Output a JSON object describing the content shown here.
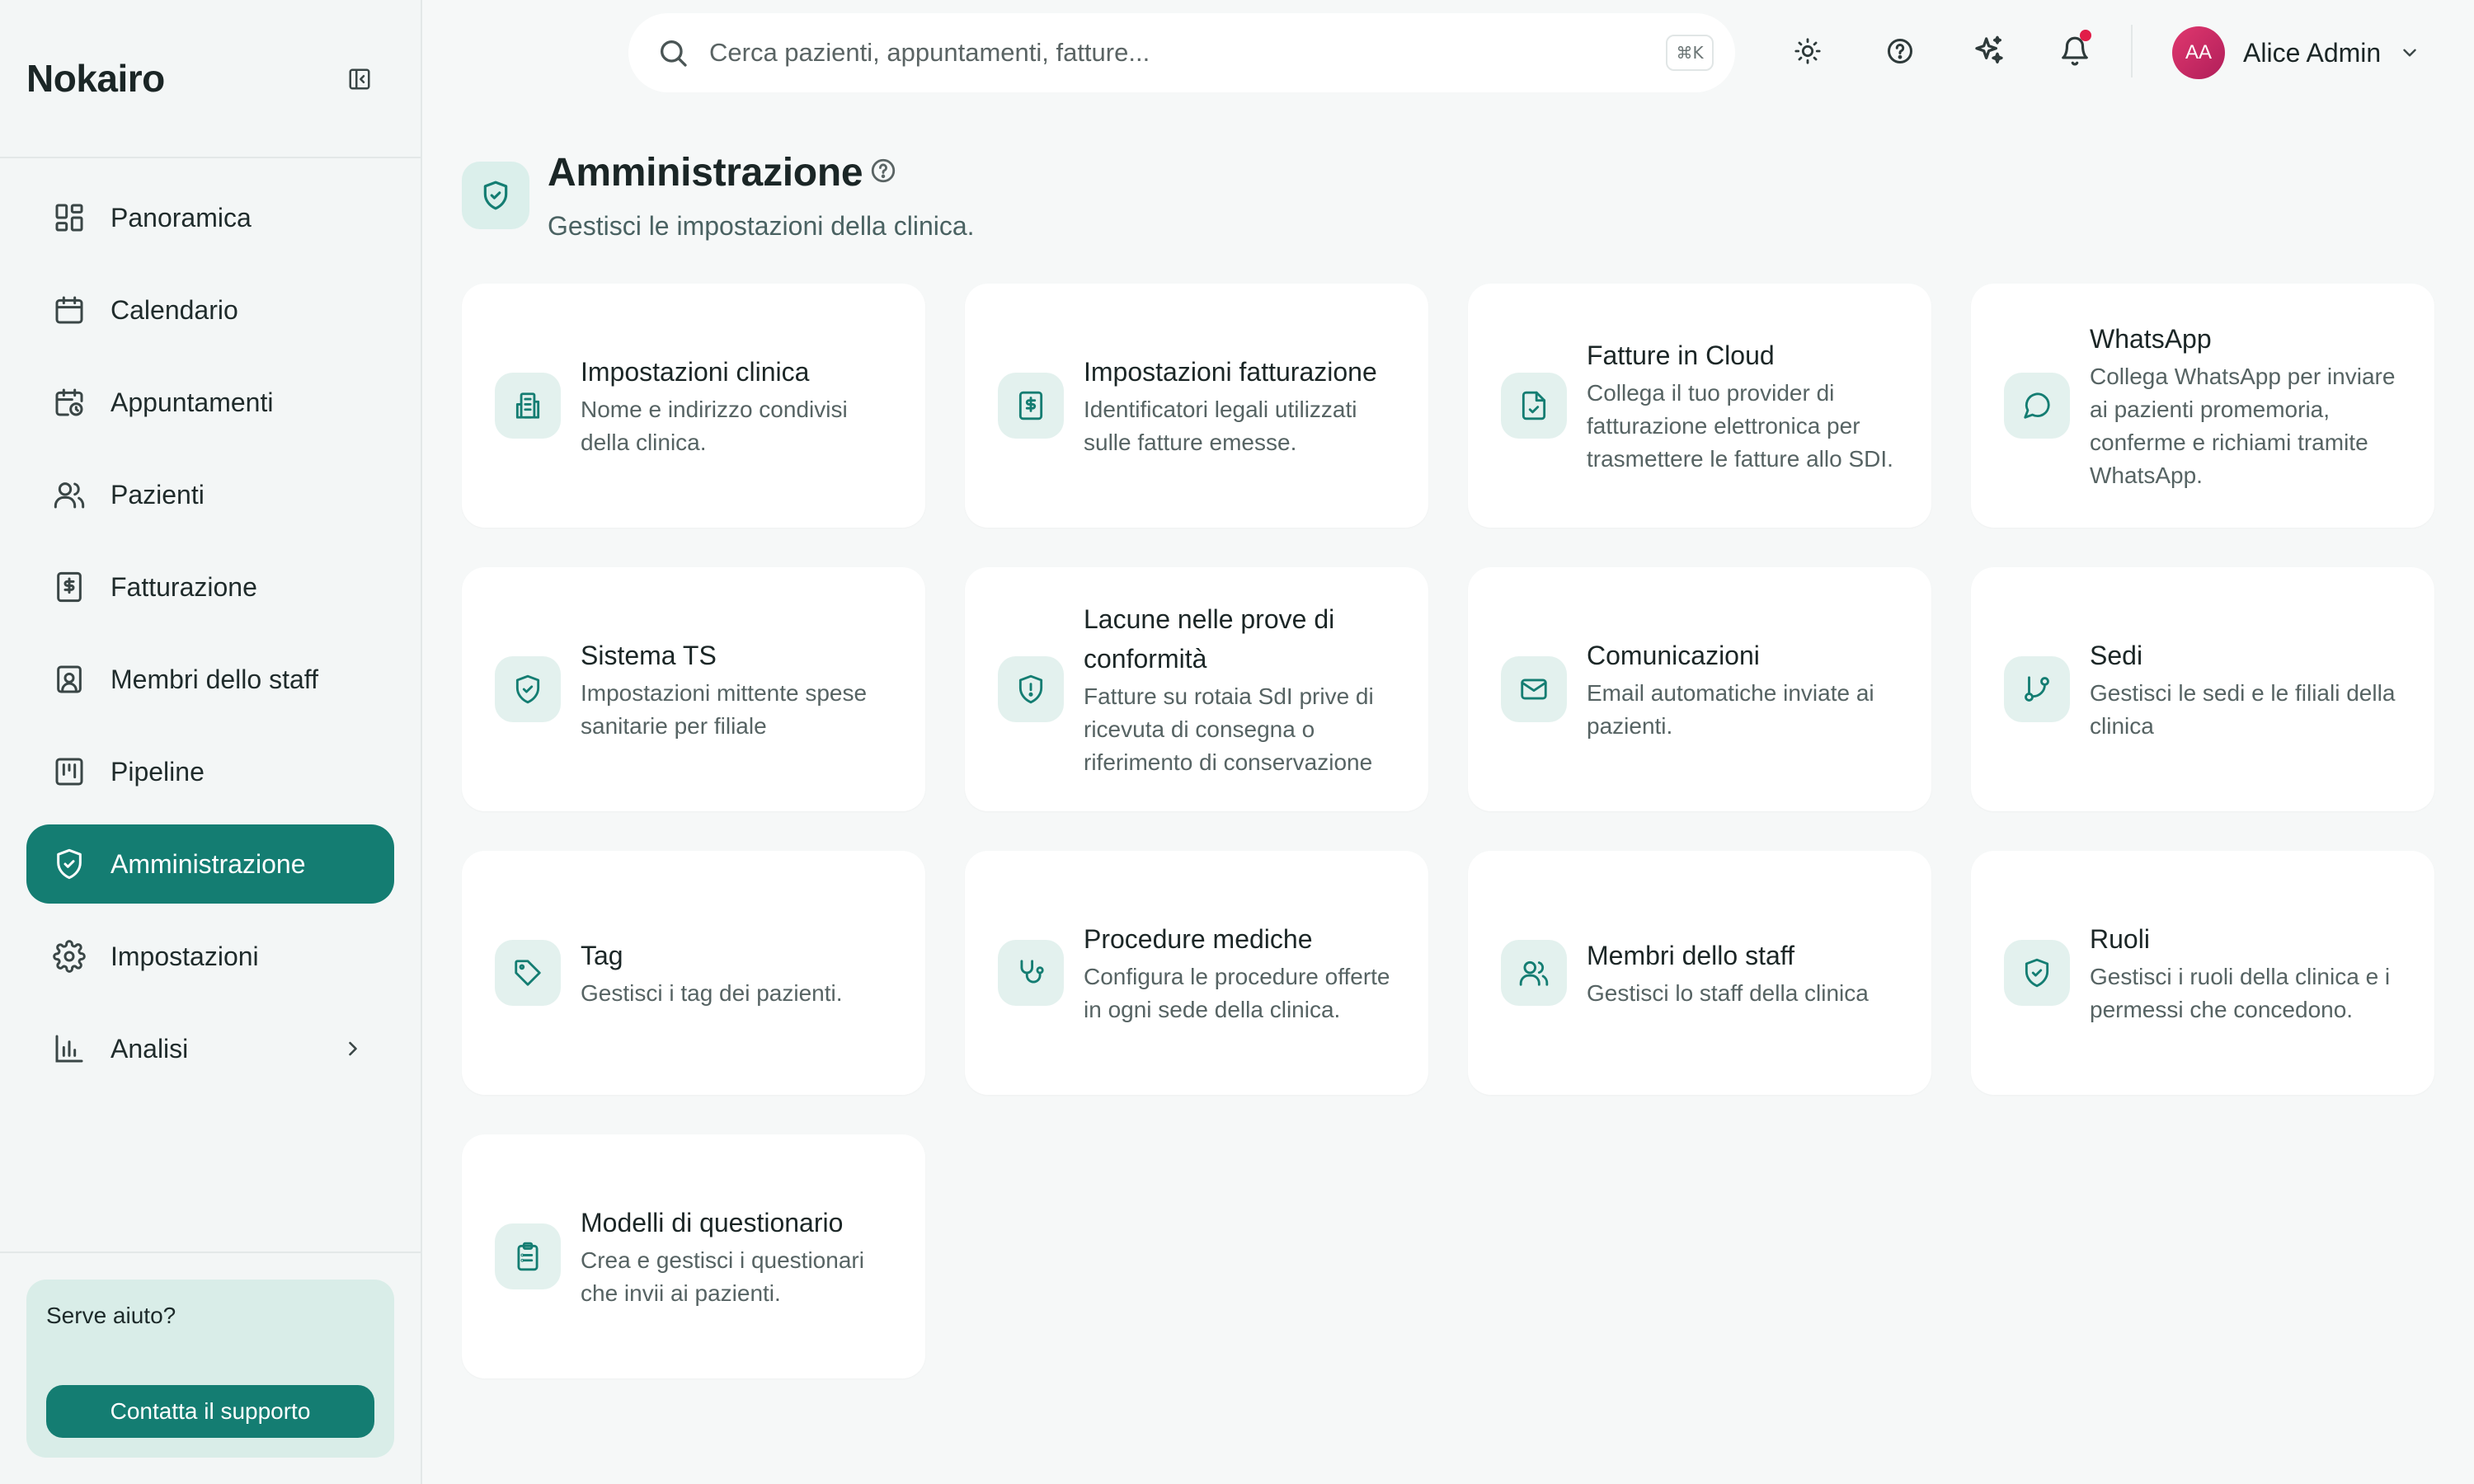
{
  "app": {
    "brand": "Nokairo"
  },
  "sidebar": {
    "items": [
      {
        "label": "Panoramica",
        "icon": "dashboard-icon"
      },
      {
        "label": "Calendario",
        "icon": "calendar-icon"
      },
      {
        "label": "Appuntamenti",
        "icon": "calendar-clock-icon"
      },
      {
        "label": "Pazienti",
        "icon": "users-icon"
      },
      {
        "label": "Fatturazione",
        "icon": "receipt-icon"
      },
      {
        "label": "Membri dello staff",
        "icon": "id-badge-icon"
      },
      {
        "label": "Pipeline",
        "icon": "kanban-icon"
      },
      {
        "label": "Amministrazione",
        "icon": "shield-check-icon",
        "active": true
      },
      {
        "label": "Impostazioni",
        "icon": "gear-icon"
      },
      {
        "label": "Analisi",
        "icon": "bar-chart-icon",
        "has_submenu": true
      }
    ],
    "help": {
      "title": "Serve aiuto?",
      "button_label": "Contatta il supporto"
    }
  },
  "topbar": {
    "search_placeholder": "Cerca pazienti, appuntamenti, fatture...",
    "search_shortcut": "⌘K",
    "user": {
      "initials": "AA",
      "name": "Alice Admin"
    }
  },
  "page": {
    "title": "Amministrazione",
    "subtitle": "Gestisci le impostazioni della clinica."
  },
  "cards": [
    {
      "title": "Impostazioni clinica",
      "desc": "Nome e indirizzo condivisi della clinica.",
      "icon": "building-icon"
    },
    {
      "title": "Impostazioni fatturazione",
      "desc": "Identificatori legali utilizzati sulle fatture emesse.",
      "icon": "receipt-icon"
    },
    {
      "title": "Fatture in Cloud",
      "desc": "Collega il tuo provider di fatturazione elettronica per trasmettere le fatture allo SDI.",
      "icon": "file-check-icon"
    },
    {
      "title": "WhatsApp",
      "desc": "Collega WhatsApp per inviare ai pazienti promemoria, conferme e richiami tramite WhatsApp.",
      "icon": "chat-bubble-icon"
    },
    {
      "title": "Sistema TS",
      "desc": "Impostazioni mittente spese sanitarie per filiale",
      "icon": "shield-check-icon"
    },
    {
      "title": "Lacune nelle prove di conformità",
      "desc": "Fatture su rotaia SdI prive di ricevuta di consegna o riferimento di conservazione",
      "icon": "shield-alert-icon"
    },
    {
      "title": "Comunicazioni",
      "desc": "Email automatiche inviate ai pazienti.",
      "icon": "mail-icon"
    },
    {
      "title": "Sedi",
      "desc": "Gestisci le sedi e le filiali della clinica",
      "icon": "git-branch-icon"
    },
    {
      "title": "Tag",
      "desc": "Gestisci i tag dei pazienti.",
      "icon": "tag-icon"
    },
    {
      "title": "Procedure mediche",
      "desc": "Configura le procedure offerte in ogni sede della clinica.",
      "icon": "stethoscope-icon"
    },
    {
      "title": "Membri dello staff",
      "desc": "Gestisci lo staff della clinica",
      "icon": "users-icon"
    },
    {
      "title": "Ruoli",
      "desc": "Gestisci i ruoli della clinica e i permessi che concedono.",
      "icon": "shield-check-icon"
    },
    {
      "title": "Modelli di questionario",
      "desc": "Crea e gestisci i questionari che invii ai pazienti.",
      "icon": "clipboard-list-icon"
    }
  ],
  "colors": {
    "accent": "#147d72",
    "accent_soft": "#e3f1ee",
    "notification": "#e11d48",
    "avatar": "#d6336c"
  }
}
